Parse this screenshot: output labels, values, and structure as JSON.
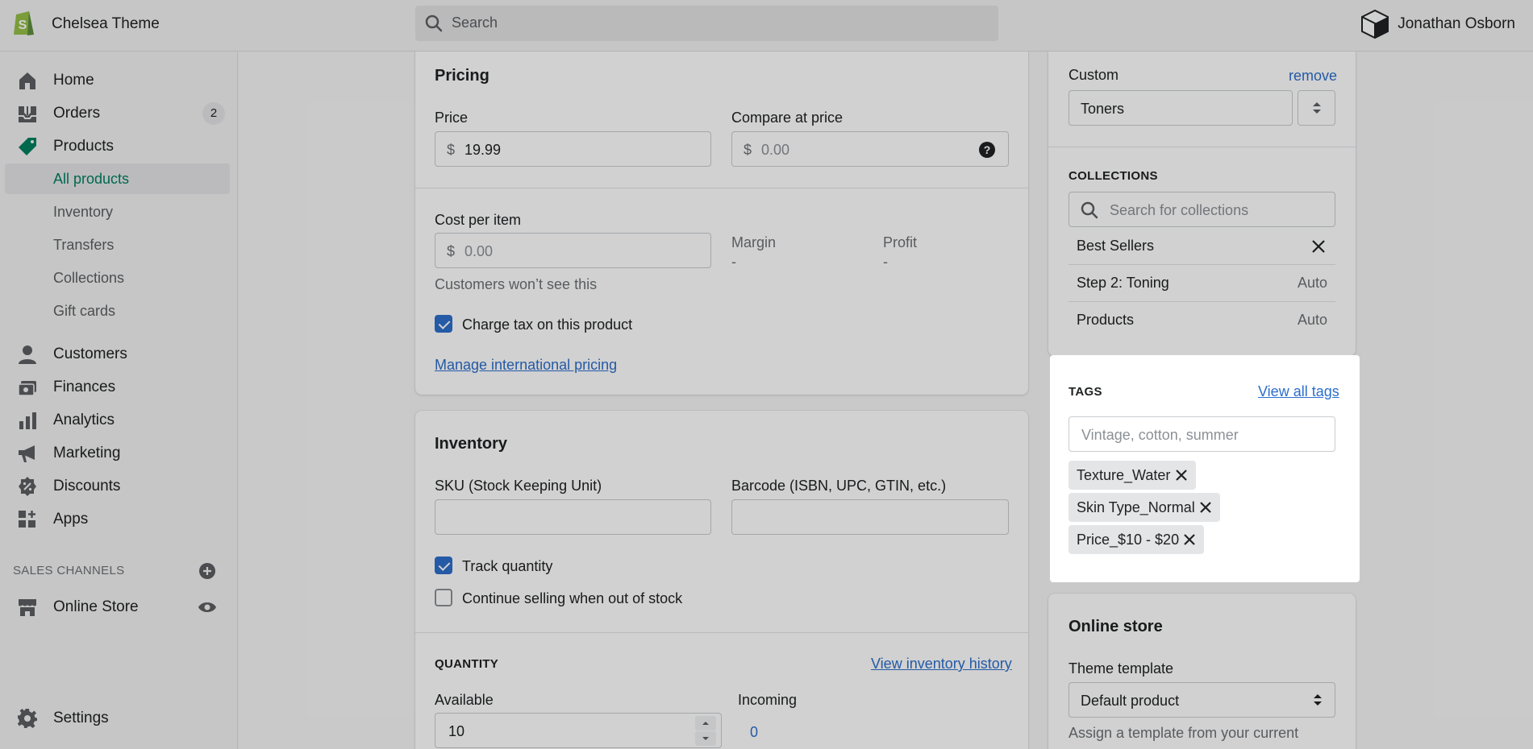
{
  "topbar": {
    "store_name": "Chelsea Theme",
    "search_placeholder": "Search",
    "user_name": "Jonathan Osborn"
  },
  "sidebar": {
    "home": "Home",
    "orders": "Orders",
    "orders_badge": "2",
    "products": "Products",
    "sub": [
      "All products",
      "Inventory",
      "Transfers",
      "Collections",
      "Gift cards"
    ],
    "customers": "Customers",
    "finances": "Finances",
    "analytics": "Analytics",
    "marketing": "Marketing",
    "discounts": "Discounts",
    "apps": "Apps",
    "sales_channels": "SALES CHANNELS",
    "online_store": "Online Store",
    "settings": "Settings"
  },
  "pricing": {
    "title": "Pricing",
    "price_label": "Price",
    "price_currency": "$",
    "price_value": "19.99",
    "compare_label": "Compare at price",
    "compare_currency": "$",
    "compare_placeholder": "0.00",
    "cost_label": "Cost per item",
    "cost_currency": "$",
    "cost_placeholder": "0.00",
    "margin_label": "Margin",
    "margin_value": "-",
    "profit_label": "Profit",
    "profit_value": "-",
    "cost_help": "Customers won’t see this",
    "charge_tax": "Charge tax on this product",
    "charge_tax_checked": true,
    "manage_intl": "Manage international pricing"
  },
  "inventory": {
    "title": "Inventory",
    "sku_label": "SKU (Stock Keeping Unit)",
    "barcode_label": "Barcode (ISBN, UPC, GTIN, etc.)",
    "track_quantity": "Track quantity",
    "track_checked": true,
    "continue_selling": "Continue selling when out of stock",
    "continue_checked": false,
    "quantity_heading": "QUANTITY",
    "view_history": "View inventory history",
    "available_label": "Available",
    "available_value": "10",
    "incoming_label": "Incoming",
    "incoming_value": "0"
  },
  "organization": {
    "custom_label": "Custom",
    "remove": "remove",
    "type_value": "Toners",
    "collections_heading": "COLLECTIONS",
    "collections_placeholder": "Search for collections",
    "collections": [
      {
        "name": "Best Sellers",
        "right": ""
      },
      {
        "name": "Step 2: Toning",
        "right": "Auto"
      },
      {
        "name": "Products",
        "right": "Auto"
      }
    ]
  },
  "tags": {
    "heading": "TAGS",
    "view_all": "View all tags",
    "placeholder": "Vintage, cotton, summer",
    "items": [
      "Texture_Water",
      "Skin Type_Normal",
      "Price_$10 - $20"
    ]
  },
  "online_store": {
    "title": "Online store",
    "template_label": "Theme template",
    "template_value": "Default product",
    "help": "Assign a template from your current"
  },
  "colors": {
    "accent": "#2c6ecb",
    "active_nav": "#007f5f",
    "logo": "#95bf47"
  }
}
